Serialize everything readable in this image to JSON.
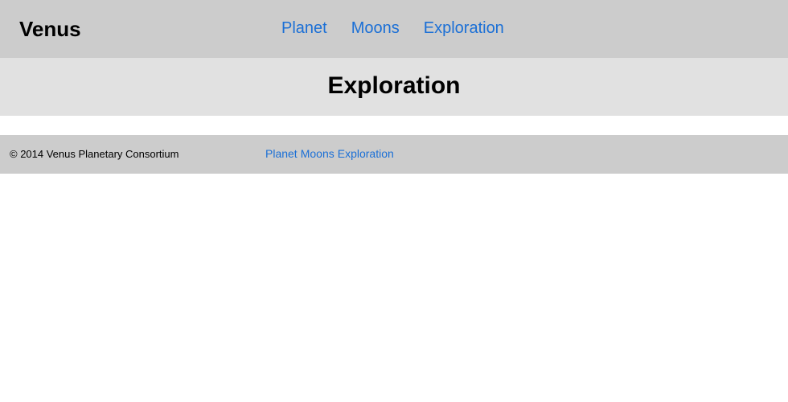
{
  "header": {
    "site_title": "Venus",
    "nav": [
      "Planet",
      "Moons",
      "Exploration"
    ]
  },
  "main": {
    "page_title": "Exploration"
  },
  "footer": {
    "copyright": "© 2014 Venus Planetary Consortium",
    "nav": [
      "Planet",
      "Moons",
      "Exploration"
    ]
  },
  "colors": {
    "header_bg": "#cccccc",
    "heading_bar_bg": "#e1e1e1",
    "link": "#1a6fd6"
  }
}
